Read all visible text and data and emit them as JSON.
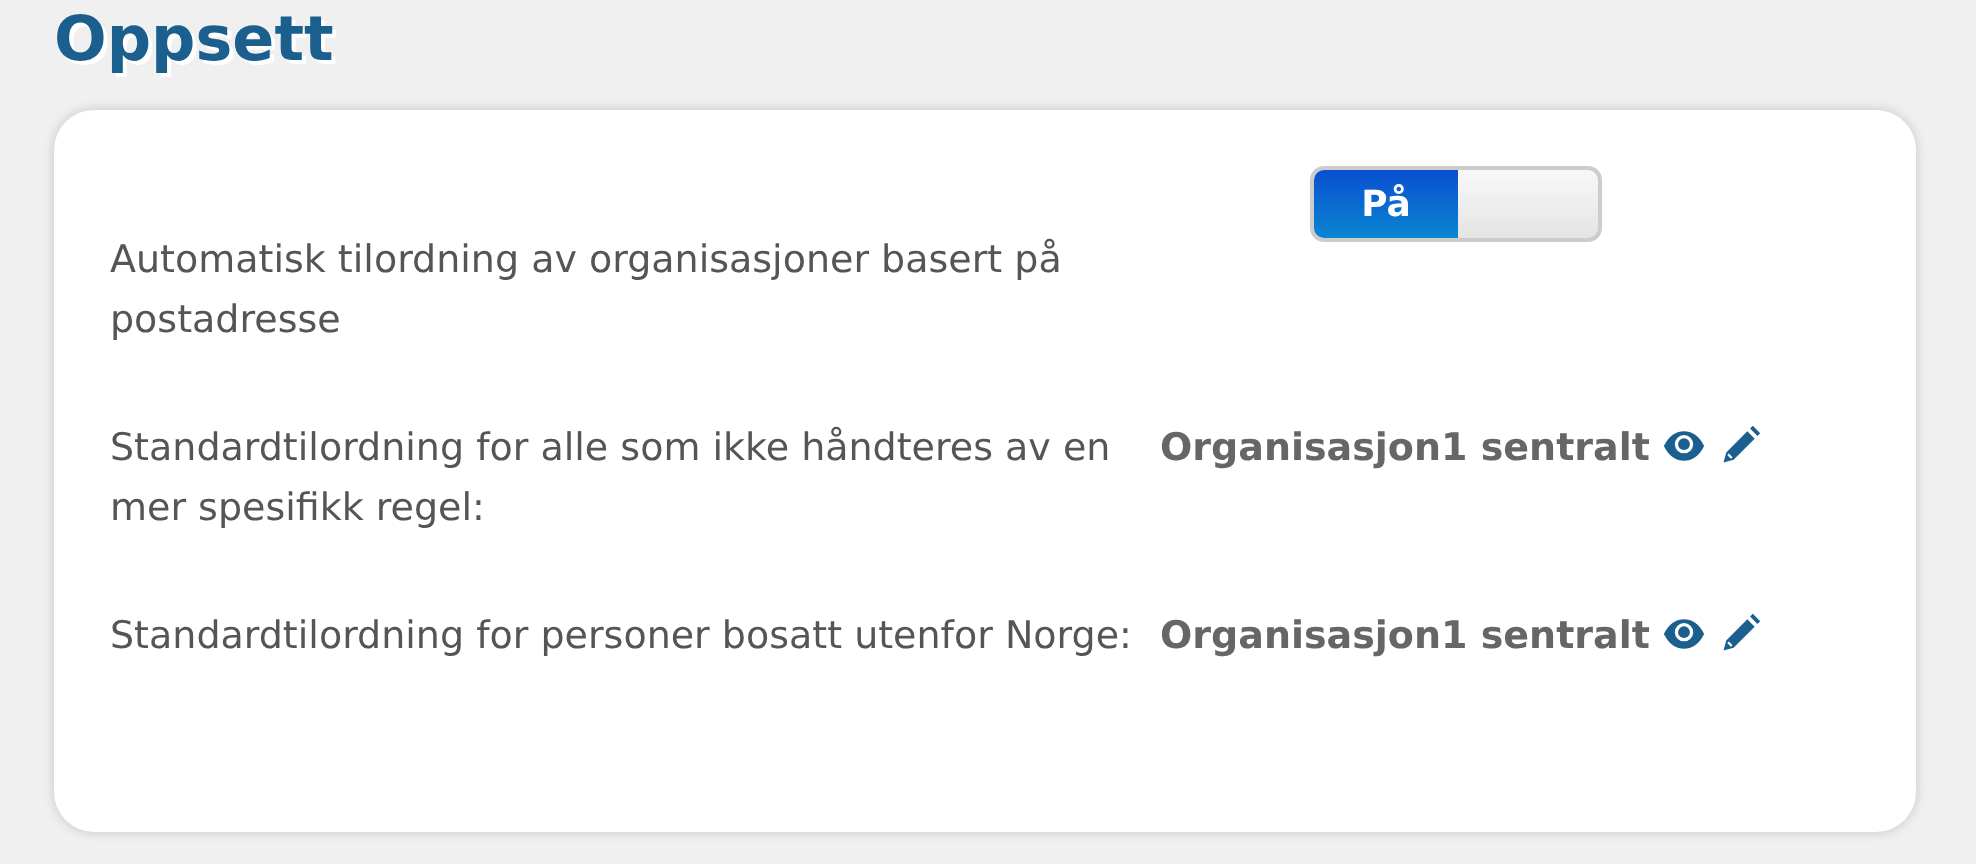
{
  "title": "Oppsett",
  "settings": [
    {
      "kind": "toggle",
      "label": "Automatisk tilordning av organisasjoner basert på postadresse",
      "toggle": {
        "on": true,
        "text": "På"
      }
    },
    {
      "kind": "assignment",
      "label": "Standardtilordning for alle som ikke håndteres av en mer spesifikk regel:",
      "value": "Organisasjon1 sentralt"
    },
    {
      "kind": "assignment",
      "label": "Standardtilordning for personer bosatt utenfor Norge:",
      "value": "Organisasjon1 sentralt"
    }
  ]
}
